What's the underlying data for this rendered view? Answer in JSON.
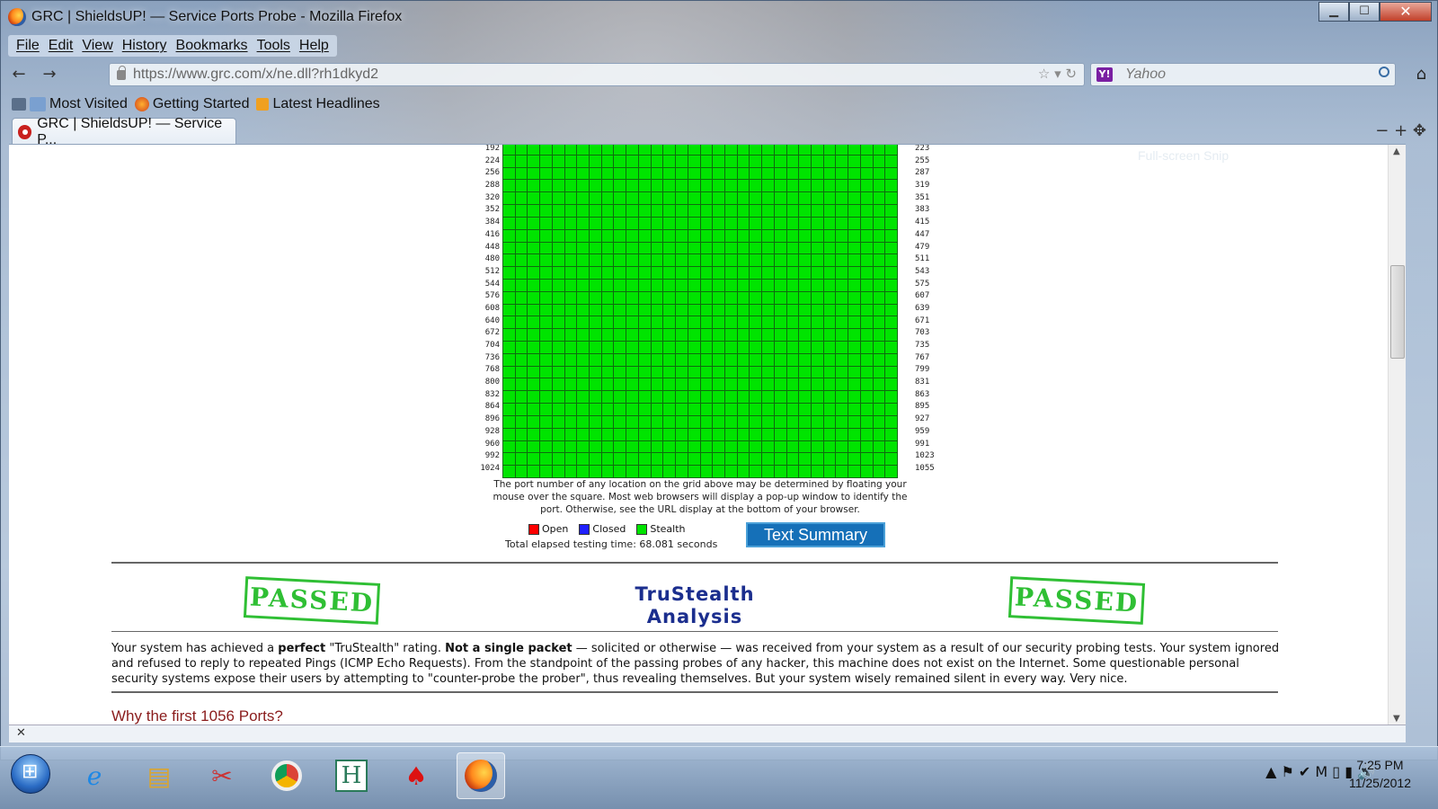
{
  "window": {
    "title": "GRC | ShieldsUP! — Service Ports Probe   - Mozilla Firefox",
    "controls": {
      "minimize": "▁",
      "maximize": "☐",
      "close": "✕"
    }
  },
  "menu": [
    "File",
    "Edit",
    "View",
    "History",
    "Bookmarks",
    "Tools",
    "Help"
  ],
  "nav": {
    "back": "←",
    "forward": "→",
    "url": "https://www.grc.com/x/ne.dll?rh1dkyd2",
    "url_icons": "☆ ▾ ↻",
    "search_engine_icon": "Y!",
    "search_placeholder": "Yahoo",
    "home": "⌂"
  },
  "bookmarks": [
    {
      "label": "Most Visited",
      "icon": "most-visited-icon"
    },
    {
      "label": "Getting Started",
      "icon": "firefox-icon"
    },
    {
      "label": "Latest Headlines",
      "icon": "rss-icon"
    }
  ],
  "tab": {
    "label": "GRC | ShieldsUP! — Service P...",
    "tools": "− + ✥"
  },
  "overlay": {
    "fullscreen_snip": "Full-screen Snip"
  },
  "port_grid": {
    "left_labels": [
      "192",
      "224",
      "256",
      "288",
      "320",
      "352",
      "384",
      "416",
      "448",
      "480",
      "512",
      "544",
      "576",
      "608",
      "640",
      "672",
      "704",
      "736",
      "768",
      "800",
      "832",
      "864",
      "896",
      "928",
      "960",
      "992",
      "1024"
    ],
    "right_labels": [
      "223",
      "255",
      "287",
      "319",
      "351",
      "383",
      "415",
      "447",
      "479",
      "511",
      "543",
      "575",
      "607",
      "639",
      "671",
      "703",
      "735",
      "767",
      "799",
      "831",
      "863",
      "895",
      "927",
      "959",
      "991",
      "1023",
      "1055"
    ],
    "rows": 27,
    "columns": 32,
    "status": "stealth",
    "note": "The port number of any location on the grid above may be determined by floating your mouse over the square. Most web browsers will display a pop-up window to identify the port. Otherwise, see the URL display at the bottom of your browser.",
    "legend": [
      {
        "label": "Open",
        "color": "#ff0000"
      },
      {
        "label": "Closed",
        "color": "#2020ff"
      },
      {
        "label": "Stealth",
        "color": "#00e400"
      }
    ],
    "elapsed": "Total elapsed testing time: 68.081 seconds",
    "text_summary_button": "Text Summary"
  },
  "trustealth": {
    "stamp": "PASSED",
    "title_line1": "TruStealth",
    "title_line2": "Analysis",
    "para_1": "Your system has achieved a ",
    "para_bold_1": "perfect",
    "para_2": " \"TruStealth\" rating. ",
    "para_bold_2": "Not a single packet",
    "para_3": " — solicited or otherwise — was received from your system as a result of our security probing tests. Your system ignored and refused to reply to repeated Pings (ICMP Echo Requests). From the standpoint of the passing probes of any hacker, this machine does not exist on the Internet. Some questionable personal security systems expose their users by attempting to \"counter-probe the prober\", thus revealing themselves. But your system wisely remained silent in every way. Very nice."
  },
  "next_section": "Why the first 1056 Ports?",
  "statusbar": {
    "close": "✕"
  },
  "taskbar": {
    "apps": [
      "internet-explorer-icon",
      "file-explorer-icon",
      "snipping-tool-icon",
      "chrome-icon",
      "h-app-icon",
      "pokerstars-icon",
      "firefox-icon"
    ],
    "tray_icons": "▲ ⚑ ✔ M ▯ ▮ 🔊",
    "time": "7:25 PM",
    "date": "11/25/2012"
  }
}
